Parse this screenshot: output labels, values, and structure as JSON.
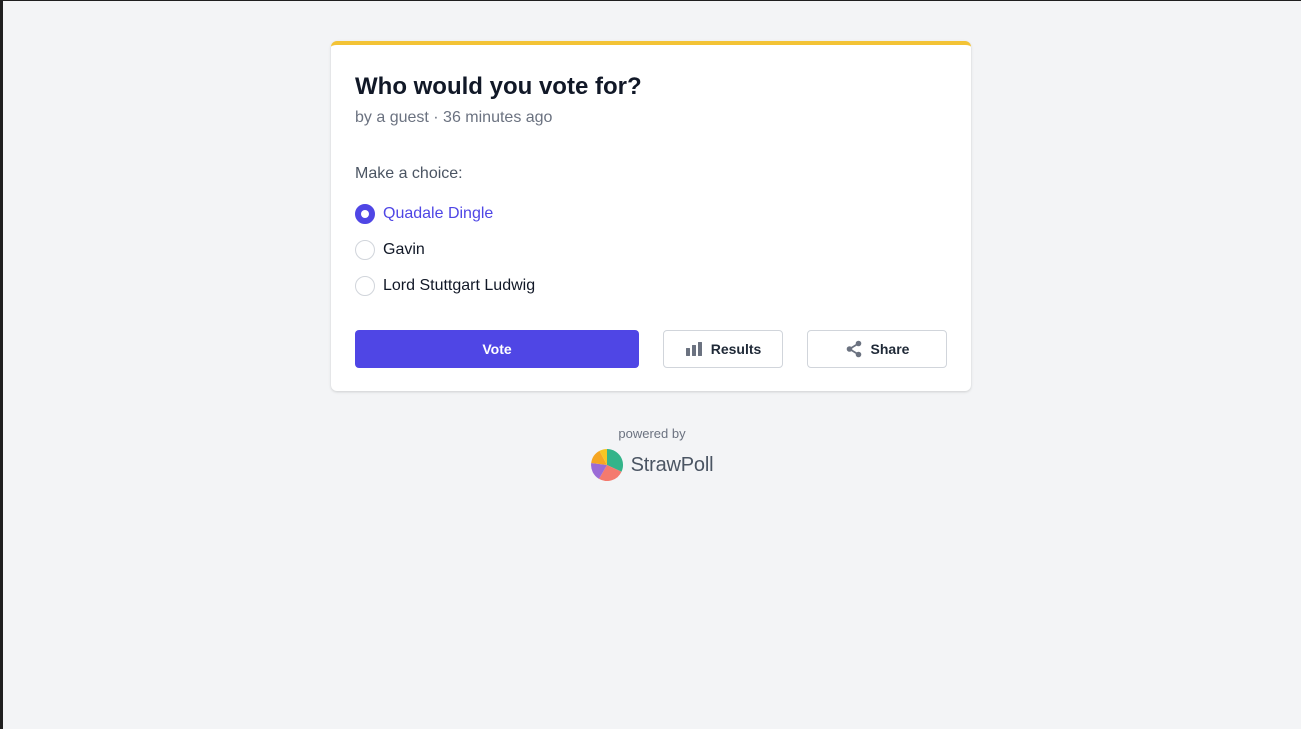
{
  "poll": {
    "title": "Who would you vote for?",
    "meta": "by a guest · 36 minutes ago",
    "choice_prompt": "Make a choice:",
    "options": [
      {
        "label": "Quadale Dingle",
        "selected": true
      },
      {
        "label": "Gavin",
        "selected": false
      },
      {
        "label": "Lord Stuttgart Ludwig",
        "selected": false
      }
    ],
    "accent_color": "#4f46e5",
    "top_bar_color": "#f3c335"
  },
  "actions": {
    "vote_label": "Vote",
    "results_label": "Results",
    "results_icon": "bar-chart-icon",
    "share_label": "Share",
    "share_icon": "share-icon"
  },
  "footer": {
    "powered_by": "powered by",
    "brand_name": "StrawPoll",
    "brand_icon": "strawpoll-logo"
  }
}
